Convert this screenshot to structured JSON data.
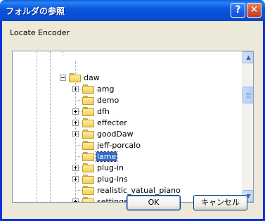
{
  "window": {
    "title": "フォルダの参照"
  },
  "description": "Locate Encoder",
  "tree": {
    "parent": "daw",
    "items": [
      {
        "label": "amg",
        "expandable": true,
        "selected": false
      },
      {
        "label": "demo",
        "expandable": false,
        "selected": false
      },
      {
        "label": "dfh",
        "expandable": true,
        "selected": false
      },
      {
        "label": "effecter",
        "expandable": true,
        "selected": false
      },
      {
        "label": "goodDaw",
        "expandable": true,
        "selected": false
      },
      {
        "label": "jeff-porcalo",
        "expandable": false,
        "selected": false
      },
      {
        "label": "lame",
        "expandable": false,
        "selected": true
      },
      {
        "label": "plug-in",
        "expandable": true,
        "selected": false
      },
      {
        "label": "plug-ins",
        "expandable": true,
        "selected": false
      },
      {
        "label": "realistic_vatual_piano",
        "expandable": false,
        "selected": false
      },
      {
        "label": "settings",
        "expandable": true,
        "selected": false
      }
    ]
  },
  "buttons": {
    "ok": "OK",
    "cancel": "キャンセル"
  },
  "colors": {
    "title_bar": "#0a50d8",
    "selection": "#316ac5",
    "dialog_bg": "#ece9d8"
  },
  "icons": {
    "help": "help-icon",
    "close": "close-icon",
    "folder": "folder-icon"
  }
}
